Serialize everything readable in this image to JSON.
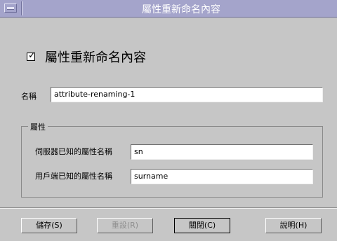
{
  "window": {
    "title": "屬性重新命名內容"
  },
  "header": {
    "checked": true,
    "title": "屬性重新命名內容"
  },
  "name": {
    "label": "名稱",
    "value": "attribute-renaming-1"
  },
  "attributes": {
    "group_label": "屬性",
    "server_label": "伺服器已知的屬性名稱",
    "server_value": "sn",
    "client_label": "用戶端已知的屬性名稱",
    "client_value": "surname"
  },
  "buttons": {
    "save": "儲存(S)",
    "reset": "重設(R)",
    "close": "關閉(C)",
    "help": "說明(H)"
  }
}
